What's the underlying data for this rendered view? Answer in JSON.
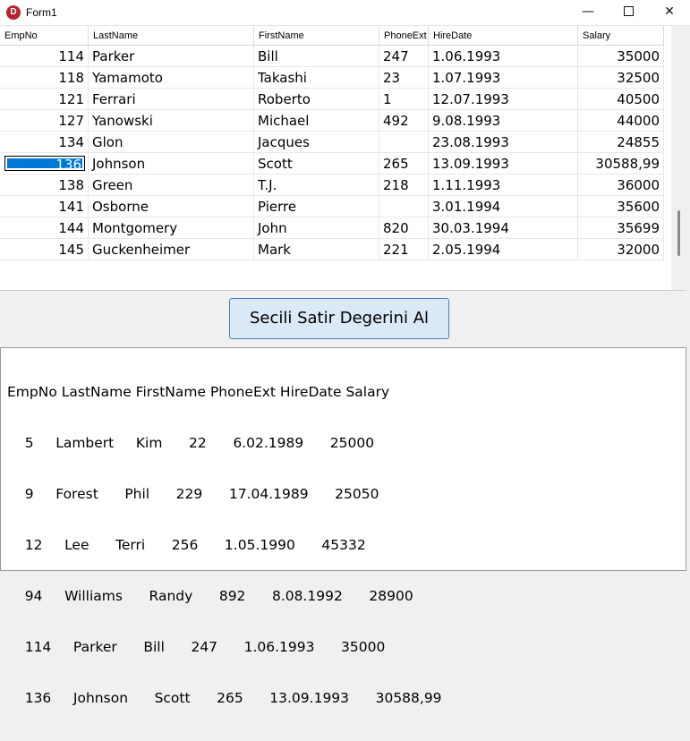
{
  "window": {
    "title": "Form1",
    "icon_letter": "D",
    "minimize_glyph": "—",
    "close_glyph": "✕"
  },
  "grid": {
    "columns": [
      "EmpNo",
      "LastName",
      "FirstName",
      "PhoneExt",
      "HireDate",
      "Salary"
    ],
    "rows": [
      {
        "EmpNo": "114",
        "LastName": "Parker",
        "FirstName": "Bill",
        "PhoneExt": "247",
        "HireDate": "1.06.1993",
        "Salary": "35000"
      },
      {
        "EmpNo": "118",
        "LastName": "Yamamoto",
        "FirstName": "Takashi",
        "PhoneExt": "23",
        "HireDate": "1.07.1993",
        "Salary": "32500"
      },
      {
        "EmpNo": "121",
        "LastName": "Ferrari",
        "FirstName": "Roberto",
        "PhoneExt": "1",
        "HireDate": "12.07.1993",
        "Salary": "40500"
      },
      {
        "EmpNo": "127",
        "LastName": "Yanowski",
        "FirstName": "Michael",
        "PhoneExt": "492",
        "HireDate": "9.08.1993",
        "Salary": "44000"
      },
      {
        "EmpNo": "134",
        "LastName": "Glon",
        "FirstName": "Jacques",
        "PhoneExt": "",
        "HireDate": "23.08.1993",
        "Salary": "24855"
      },
      {
        "EmpNo": "136",
        "LastName": "Johnson",
        "FirstName": "Scott",
        "PhoneExt": "265",
        "HireDate": "13.09.1993",
        "Salary": "30588,99"
      },
      {
        "EmpNo": "138",
        "LastName": "Green",
        "FirstName": "T.J.",
        "PhoneExt": "218",
        "HireDate": "1.11.1993",
        "Salary": "36000"
      },
      {
        "EmpNo": "141",
        "LastName": "Osborne",
        "FirstName": "Pierre",
        "PhoneExt": "",
        "HireDate": "3.01.1994",
        "Salary": "35600"
      },
      {
        "EmpNo": "144",
        "LastName": "Montgomery",
        "FirstName": "John",
        "PhoneExt": "820",
        "HireDate": "30.03.1994",
        "Salary": "35699"
      },
      {
        "EmpNo": "145",
        "LastName": "Guckenheimer",
        "FirstName": "Mark",
        "PhoneExt": "221",
        "HireDate": "2.05.1994",
        "Salary": "32000"
      }
    ],
    "selected_row_index": 5
  },
  "button": {
    "label": "Secili Satir Degerini Al"
  },
  "memo": {
    "lines": [
      "EmpNo LastName FirstName PhoneExt HireDate Salary",
      "    5     Lambert     Kim      22      6.02.1989      25000",
      "    9     Forest      Phil      229      17.04.1989      25050",
      "    12     Lee      Terri      256      1.05.1990      45332",
      "    94     Williams      Randy      892      8.08.1992      28900",
      "    114     Parker      Bill      247      1.06.1993      35000",
      "    136     Johnson      Scott      265      13.09.1993      30588,99"
    ]
  }
}
